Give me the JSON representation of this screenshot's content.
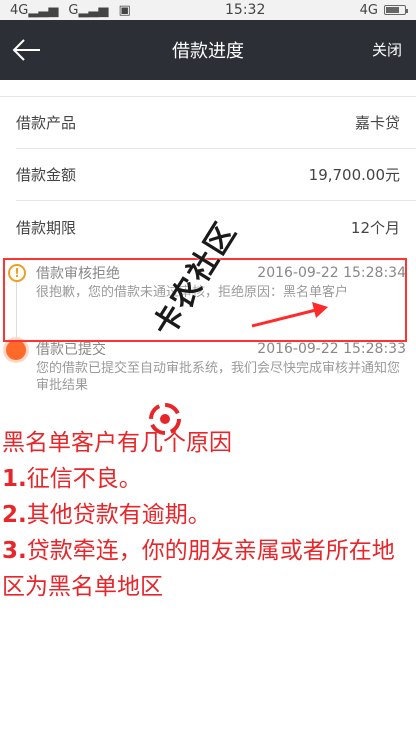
{
  "status_bar": {
    "carrier1": "4G",
    "carrier2": "G",
    "time": "15:32",
    "right_network": "4G",
    "battery_level": 0.7
  },
  "nav": {
    "back_icon": "back-arrow-icon",
    "title": "借款进度",
    "close_label": "关闭"
  },
  "info": {
    "rows": [
      {
        "label": "借款产品",
        "value": "嘉卡贷"
      },
      {
        "label": "借款金额",
        "value": "19,700.00元"
      },
      {
        "label": "借款期限",
        "value": "12个月"
      }
    ]
  },
  "timeline": {
    "items": [
      {
        "title": "借款审核拒绝",
        "time": "2016-09-22 15:28:34",
        "desc": "很抱歉，您的借款未通过审核，拒绝原因：黑名单客户",
        "icon": "warning-icon",
        "color": "#f0a020"
      },
      {
        "title": "借款已提交",
        "time": "2016-09-22 15:28:33",
        "desc": "您的借款已提交至自动审批系统，我们会尽快完成审核并通知您审批结果",
        "icon": "dot-icon",
        "color": "#ff6a2a"
      }
    ]
  },
  "watermark": {
    "text": "卡农社区"
  },
  "annotation": {
    "title": "黑名单客户有几个原因",
    "items": [
      {
        "num": "1.",
        "text": "征信不良。"
      },
      {
        "num": "2.",
        "text": "其他贷款有逾期。"
      },
      {
        "num": "3.",
        "text": "贷款牵连，你的朋友亲属或者所在地区为黑名单地区"
      }
    ],
    "color": "#e8262a"
  }
}
